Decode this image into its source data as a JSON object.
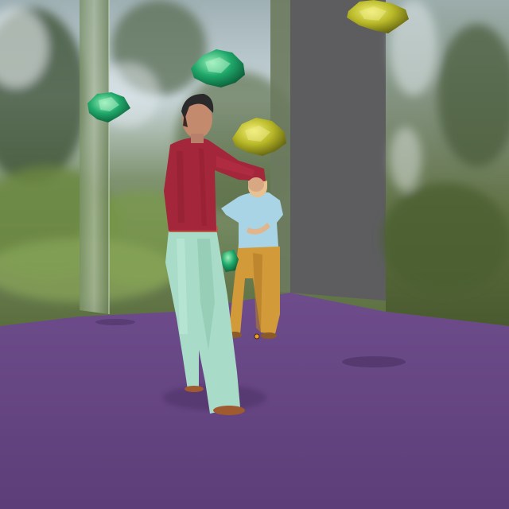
{
  "scene": {
    "type": "3d-render",
    "environment": "forest-backdrop",
    "colors": {
      "floor": "#6a4a86",
      "floor_dark": "#4f3468",
      "wall_gray": "#5d5d60",
      "sky": "#b8c8cc",
      "foliage": "#4d6a3a",
      "shirt_red": "#a3263a",
      "pants_mint": "#a8dcc8",
      "shirt_blue": "#a8d4e6",
      "pants_orange": "#d39a3a",
      "gem_green": "#1fa86a",
      "gem_yellow": "#c2c22a",
      "marker": "#f0a020"
    },
    "objects": [
      "mirror-panel-left",
      "mirror-panel-right",
      "gray-pillar",
      "player-character-red-shirt",
      "npc-character-blue-shirt",
      "floating-gem-yellow-top",
      "floating-gem-green",
      "floating-gem-small-green",
      "floating-gem-yellow",
      "floor-marker"
    ]
  }
}
